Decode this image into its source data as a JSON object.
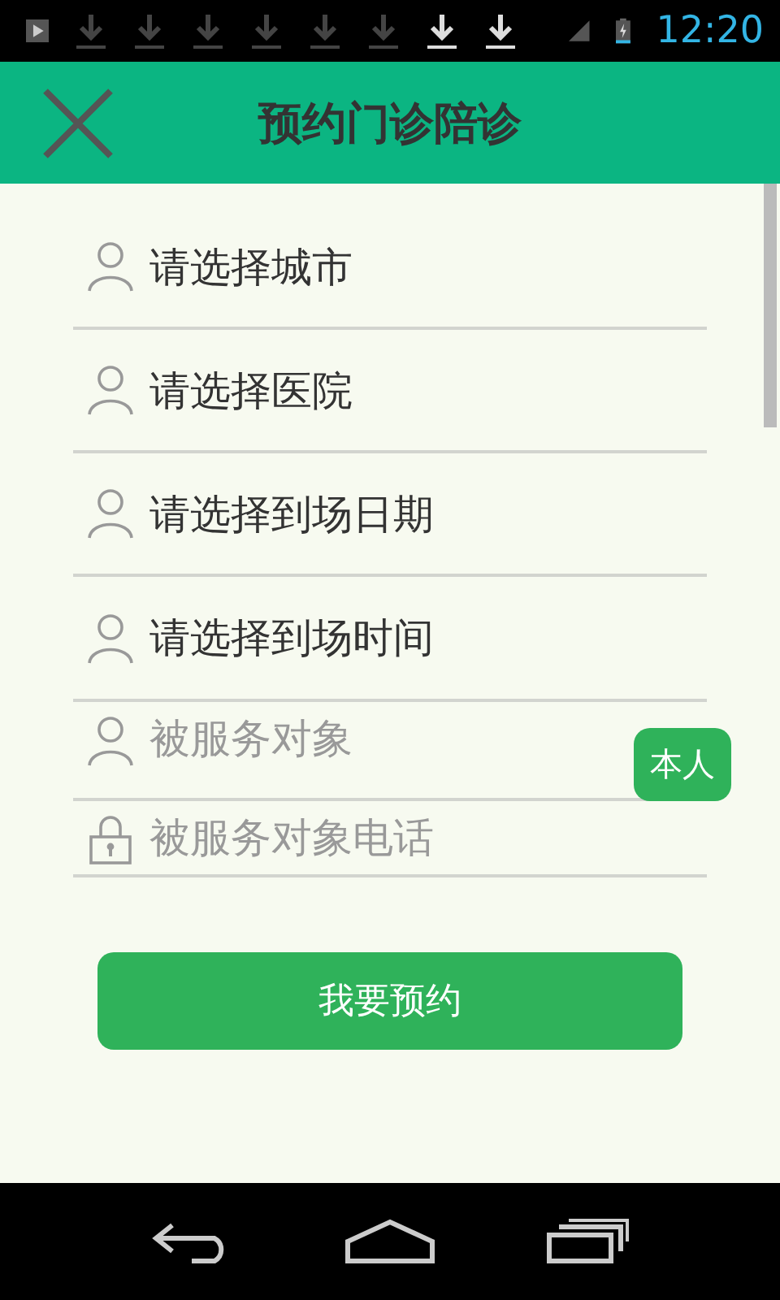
{
  "status_bar": {
    "time": "12:20"
  },
  "header": {
    "title": "预约门诊陪诊"
  },
  "form": {
    "rows": [
      {
        "kind": "select",
        "value": "请选择城市"
      },
      {
        "kind": "select",
        "value": "请选择医院"
      },
      {
        "kind": "select",
        "value": "请选择到场日期"
      },
      {
        "kind": "select",
        "value": "请选择到场时间"
      },
      {
        "kind": "input",
        "placeholder": "被服务对象",
        "button": "本人"
      },
      {
        "kind": "phone",
        "placeholder": "被服务对象电话"
      }
    ]
  },
  "submit": {
    "label": "我要预约"
  }
}
